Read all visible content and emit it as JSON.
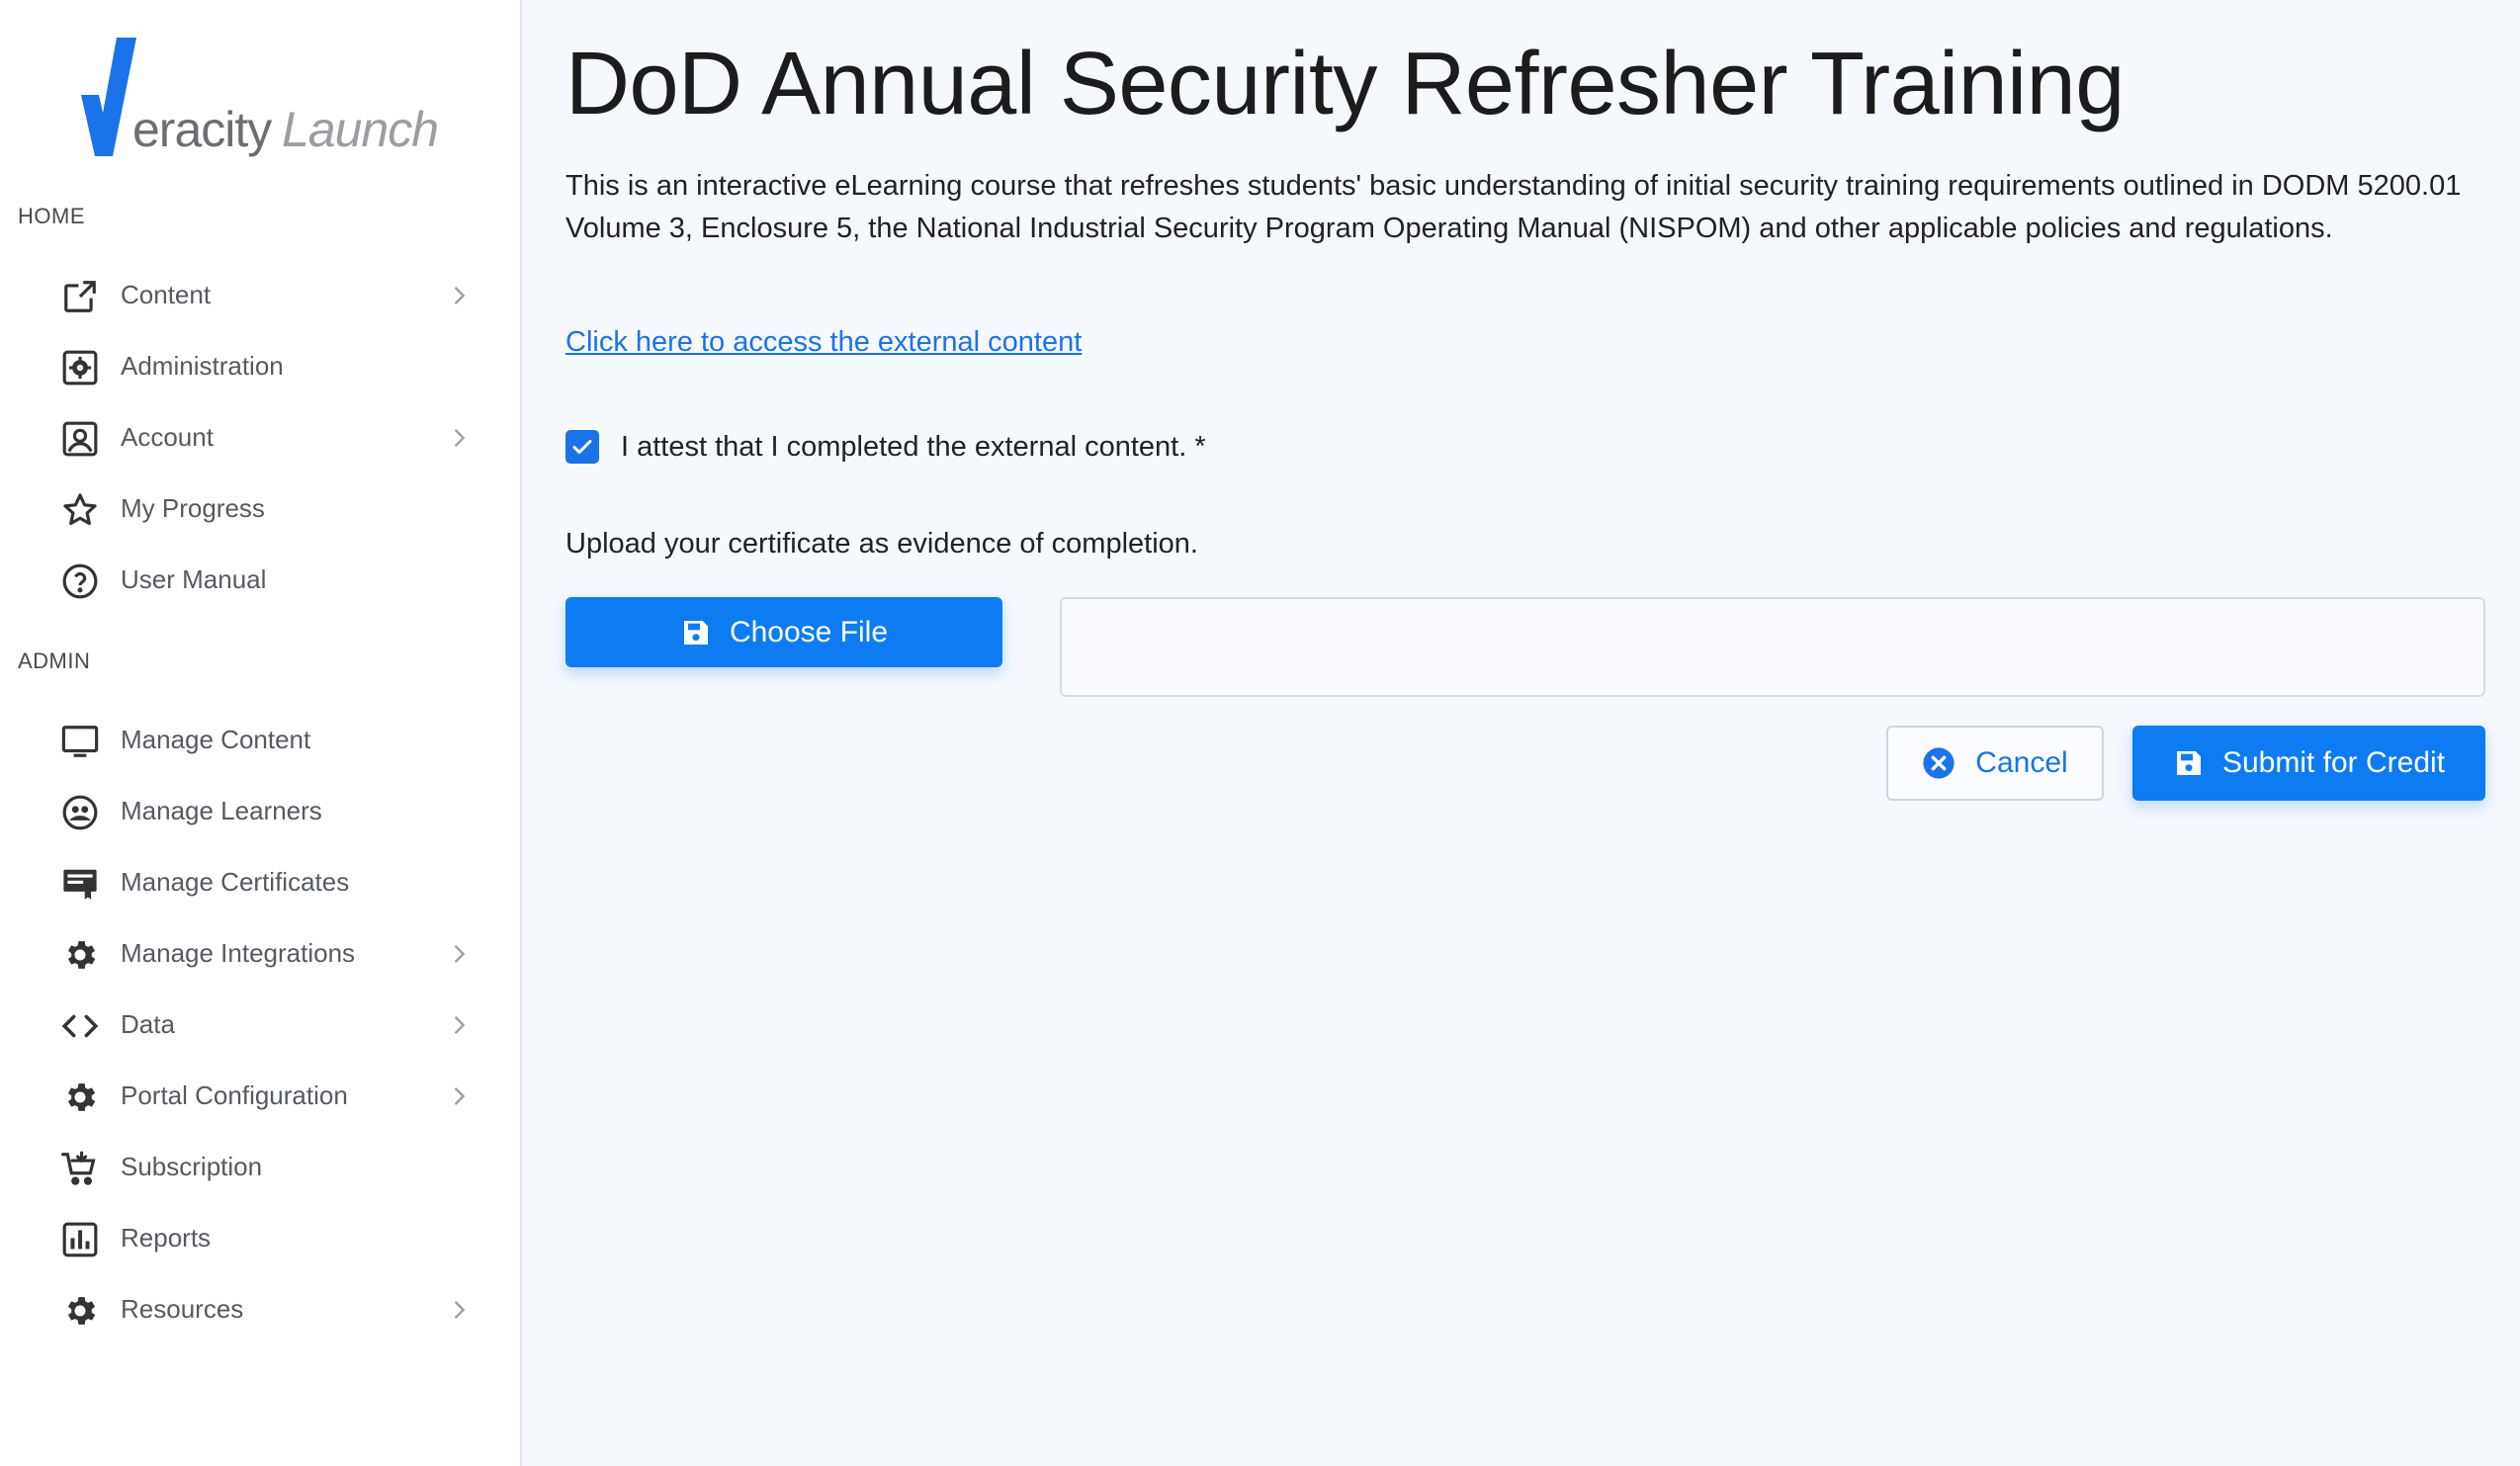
{
  "brand": {
    "name_part1": "eracity",
    "name_part2": "Launch",
    "accent_color": "#1a73e8"
  },
  "sidebar": {
    "home_label": "HOME",
    "admin_label": "ADMIN",
    "home_items": [
      {
        "label": "Content",
        "icon": "external-link-icon",
        "has_chevron": true
      },
      {
        "label": "Administration",
        "icon": "admin-gear-box-icon",
        "has_chevron": false
      },
      {
        "label": "Account",
        "icon": "account-portrait-icon",
        "has_chevron": true
      },
      {
        "label": "My Progress",
        "icon": "star-icon",
        "has_chevron": false
      },
      {
        "label": "User Manual",
        "icon": "help-circle-icon",
        "has_chevron": false
      }
    ],
    "admin_items": [
      {
        "label": "Manage Content",
        "icon": "monitor-icon",
        "has_chevron": false
      },
      {
        "label": "Manage Learners",
        "icon": "learners-face-icon",
        "has_chevron": false
      },
      {
        "label": "Manage Certificates",
        "icon": "certificate-icon",
        "has_chevron": false
      },
      {
        "label": "Manage Integrations",
        "icon": "gear-icon",
        "has_chevron": true
      },
      {
        "label": "Data",
        "icon": "code-brackets-icon",
        "has_chevron": true
      },
      {
        "label": "Portal Configuration",
        "icon": "gear-icon",
        "has_chevron": true
      },
      {
        "label": "Subscription",
        "icon": "cart-icon",
        "has_chevron": false
      },
      {
        "label": "Reports",
        "icon": "bar-chart-icon",
        "has_chevron": false
      },
      {
        "label": "Resources",
        "icon": "gear-icon",
        "has_chevron": true
      }
    ]
  },
  "main": {
    "title": "DoD Annual Security Refresher Training",
    "description": "This is an interactive eLearning course that refreshes students' basic understanding of initial security training requirements outlined in DODM 5200.01 Volume 3, Enclosure 5, the National Industrial Security Program Operating Manual (NISPOM) and other applicable policies and regulations.",
    "external_link": "Click here to access the external content",
    "attest_label": "I attest that I completed the external content. *",
    "attest_checked": true,
    "upload_label": "Upload your certificate as evidence of completion.",
    "choose_file_label": "Choose File",
    "file_value": "",
    "cancel_label": "Cancel",
    "submit_label": "Submit for Credit"
  }
}
